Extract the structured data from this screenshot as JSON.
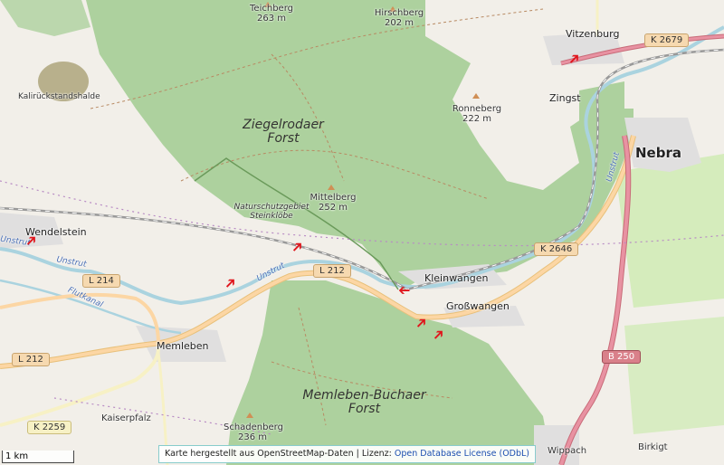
{
  "map": {
    "places": {
      "wendelstein": "Wendelstein",
      "memleben": "Memleben",
      "kaiserpfalz": "Kaiserpfalz",
      "kleinwangen": "Kleinwangen",
      "grosswangen": "Großwangen",
      "vitzenburg": "Vitzenburg",
      "zingst": "Zingst",
      "nebra": "Nebra",
      "wippach": "Wippach",
      "birkigt": "Birkigt",
      "kalirueckstandshalde": "Kalirückstandshalde"
    },
    "forests": {
      "ziegelrodaer_1": "Ziegelrodaer",
      "ziegelrodaer_2": "Forst",
      "memleben_buchaer_1": "Memleben-Buchaer",
      "memleben_buchaer_2": "Forst"
    },
    "nature_reserve": {
      "line1": "Naturschutzgebiet",
      "line2": "Steinklöbe"
    },
    "peaks": [
      {
        "name": "Teichberg",
        "elevation": "263 m"
      },
      {
        "name": "Hirschberg",
        "elevation": "202 m"
      },
      {
        "name": "Ronneberg",
        "elevation": "222 m"
      },
      {
        "name": "Mittelberg",
        "elevation": "252 m"
      },
      {
        "name": "Schadenberg",
        "elevation": "236 m"
      }
    ],
    "water": {
      "unstrut_1": "Unstrut",
      "unstrut_2": "Unstrut",
      "unstrut_3": "Unstrut",
      "flutkanal": "Flutkanal"
    },
    "roads": {
      "k2679": "K 2679",
      "k2646": "K 2646",
      "l212_a": "L 212",
      "l212_b": "L 212",
      "l214": "L 214",
      "k2259": "K 2259",
      "b250": "B 250"
    },
    "arrow_glyph": "➔"
  },
  "scale": {
    "label": "1 km"
  },
  "attribution": {
    "prefix": "Karte hergestellt aus OpenStreetMap-Daten | Lizenz:",
    "link": "Open Database License (ODbL)"
  },
  "colors": {
    "background": "#f2efe9",
    "forest": "#add19e",
    "river": "#aad3df",
    "road_primary": "#fcd6a4",
    "road_trunk": "#f9b29c",
    "railway": "#999999",
    "arrow": "#e0161d"
  }
}
